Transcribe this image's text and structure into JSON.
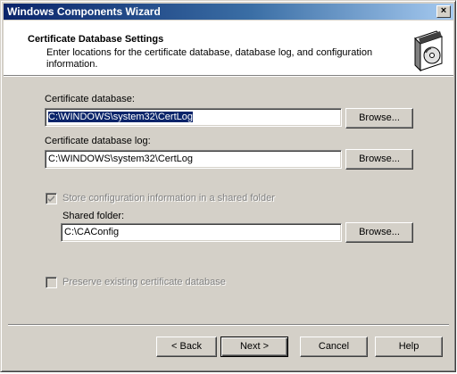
{
  "window": {
    "title": "Windows Components Wizard",
    "close_glyph": "×"
  },
  "header": {
    "title": "Certificate Database Settings",
    "description": "Enter locations for the certificate database, database log, and configuration information.",
    "icon": "software-box-cd-icon"
  },
  "fields": {
    "cert_db_label": "Certificate database:",
    "cert_db_value": "C:\\WINDOWS\\system32\\CertLog",
    "cert_log_label": "Certificate database log:",
    "cert_log_value": "C:\\WINDOWS\\system32\\CertLog",
    "browse_label": "Browse...",
    "store_shared_label": "Store configuration information in a shared folder",
    "store_shared_checked": true,
    "shared_folder_label": "Shared folder:",
    "shared_folder_value": "C:\\CAConfig",
    "preserve_label": "Preserve existing certificate database",
    "preserve_checked": false
  },
  "footer": {
    "back": "< Back",
    "next": "Next >",
    "cancel": "Cancel",
    "help": "Help"
  },
  "colors": {
    "title_gradient_start": "#0a246a",
    "title_gradient_end": "#a6caf0",
    "dialog_face": "#d4d0c8",
    "selection": "#0a246a"
  }
}
